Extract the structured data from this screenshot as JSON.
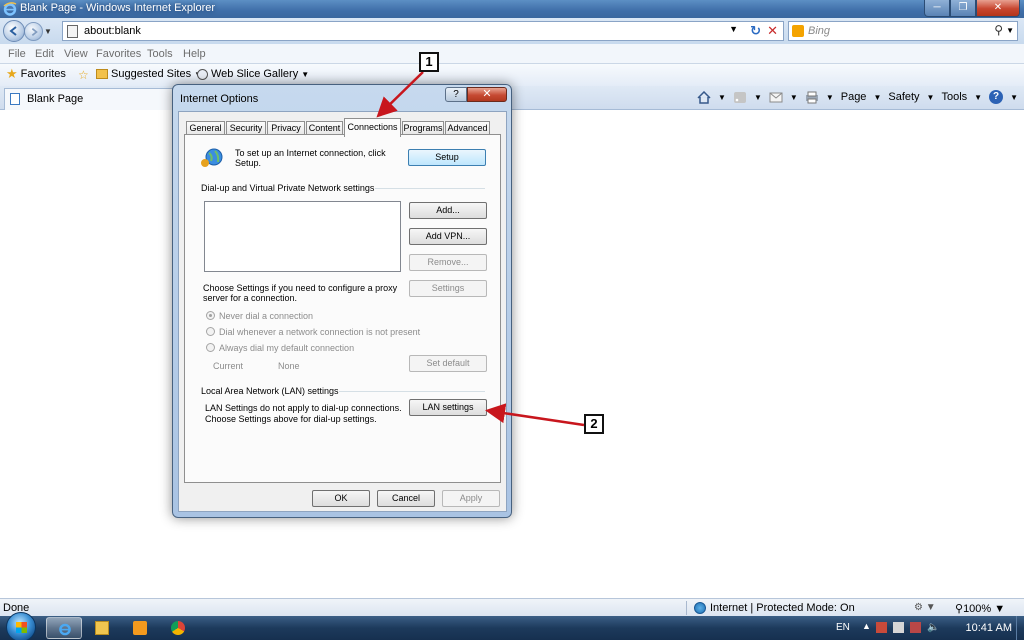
{
  "window": {
    "title": "Blank Page - Windows Internet Explorer",
    "address": "about:blank",
    "search_placeholder": "Bing"
  },
  "menubar": [
    "File",
    "Edit",
    "View",
    "Favorites",
    "Tools",
    "Help"
  ],
  "favorites_bar": {
    "favorites_label": "Favorites",
    "suggested_sites": "Suggested Sites",
    "web_slice_gallery": "Web Slice Gallery"
  },
  "tab": {
    "label": "Blank Page"
  },
  "command_bar": {
    "page": "Page",
    "safety": "Safety",
    "tools": "Tools"
  },
  "statusbar": {
    "status": "Done",
    "zone": "Internet | Protected Mode: On",
    "zoom": "100%"
  },
  "taskbar": {
    "language": "EN",
    "time": "10:41 AM"
  },
  "dialog": {
    "title": "Internet Options",
    "help": "?",
    "tabs": [
      "General",
      "Security",
      "Privacy",
      "Content",
      "Connections",
      "Programs",
      "Advanced"
    ],
    "active_tab": "Connections",
    "setup_text": "To set up an Internet connection, click Setup.",
    "setup_button": "Setup",
    "dialup_group": "Dial-up and Virtual Private Network settings",
    "add_button": "Add...",
    "add_vpn_button": "Add VPN...",
    "remove_button": "Remove...",
    "settings_text": "Choose Settings if you need to configure a proxy server for a connection.",
    "settings_button": "Settings",
    "radio_never": "Never dial a connection",
    "radio_dial_when_absent": "Dial whenever a network connection is not present",
    "radio_always": "Always dial my default connection",
    "current_label": "Current",
    "current_value": "None",
    "set_default_button": "Set default",
    "lan_group": "Local Area Network (LAN) settings",
    "lan_text_1": "LAN Settings do not apply to dial-up connections.",
    "lan_text_2": "Choose Settings above for dial-up settings.",
    "lan_button": "LAN settings",
    "ok": "OK",
    "cancel": "Cancel",
    "apply": "Apply"
  },
  "annotations": {
    "step1": "1",
    "step2": "2",
    "arrow_color": "#c8161d"
  },
  "colors": {
    "accent": "#3c7fb1",
    "title_bar": "#4676ad",
    "close_red": "#c64a33"
  }
}
